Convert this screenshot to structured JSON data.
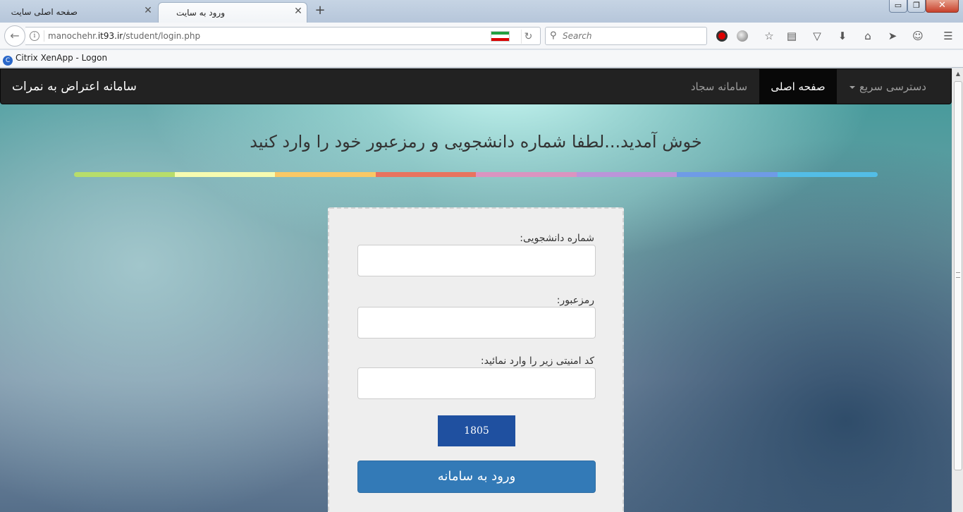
{
  "browser": {
    "tabs": [
      {
        "title": "صفحه اصلی سایت",
        "active": false
      },
      {
        "title": "ورود به سایت",
        "active": true
      }
    ],
    "new_tab": "+",
    "close_glyph": "✕",
    "url": {
      "prefix": "manochehr.",
      "host": "it93.ir",
      "path": "/student/login.php"
    },
    "search_placeholder": "Search",
    "bookmark": "Citrix XenApp - Logon",
    "flag_colors": [
      "#239f40",
      "#ffffff",
      "#da0000"
    ],
    "window_controls": {
      "minimize": "▭",
      "maximize": "❐",
      "close": "✕"
    },
    "toolbar_icons": [
      "record-icon",
      "globe-icon",
      "bookmark-star-icon",
      "reader-icon",
      "pocket-icon",
      "download-icon",
      "home-icon",
      "send-icon",
      "smiley-icon",
      "menu-icon"
    ]
  },
  "site": {
    "brand": "سامانه اعتراض به نمرات",
    "nav": {
      "quick_access": "دسترسی سریع",
      "home": "صفحه اصلی",
      "sajjad": "سامانه سجاد"
    },
    "welcome": "خوش آمدید...لطفا شماره دانشجویی و رمزعبور خود را وارد کنید",
    "rainbow_colors": [
      "#b7dd6b",
      "#f6fbb0",
      "#f9c865",
      "#e8735f",
      "#da94c0",
      "#bb95d9",
      "#6f9be6",
      "#53bde6"
    ]
  },
  "login": {
    "student_id_label": "شماره دانشجویی:",
    "student_id_value": "",
    "password_label": "رمزعبور:",
    "password_value": "",
    "captcha_label": "کد امنیتی زیر را وارد نمائید:",
    "captcha_input_value": "",
    "captcha_code": "1805",
    "submit": "ورود به سامانه"
  }
}
